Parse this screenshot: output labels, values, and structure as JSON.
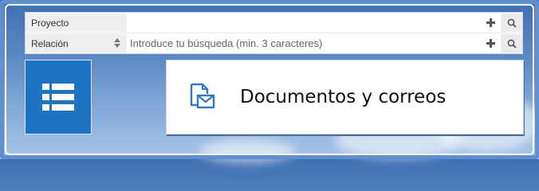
{
  "search_panel": {
    "project": {
      "label": "Proyecto",
      "value": ""
    },
    "relation": {
      "label": "Relación",
      "placeholder": "Introduce tu búsqueda (min. 3 caracteres)"
    }
  },
  "tiles": {
    "list_tile": {
      "icon": "list-icon",
      "color": "#1e74c4"
    },
    "documents_tile": {
      "icon": "document-mail-icon",
      "title": "Documentos y correos"
    }
  },
  "colors": {
    "accent": "#1e74c4",
    "label_bg": "#eceeef"
  }
}
